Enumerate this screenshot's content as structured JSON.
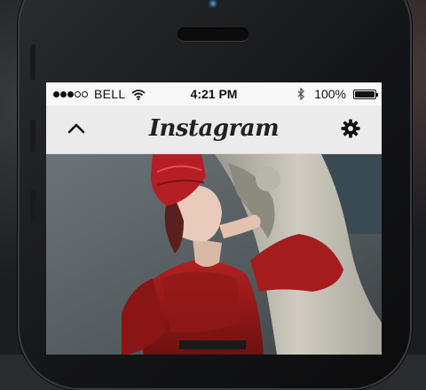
{
  "status_bar": {
    "signal_bars_filled": 3,
    "signal_bars_total": 5,
    "carrier": "BELL",
    "time": "4:21 PM",
    "battery": "100%"
  },
  "nav": {
    "title": "Instagram",
    "left_icon": "chevron-up-icon",
    "right_icon": "gear-icon"
  },
  "colors": {
    "nav_bg": "#ebebeb",
    "status_bg": "#f8f8f8",
    "dress_red": "#a01c1c"
  }
}
